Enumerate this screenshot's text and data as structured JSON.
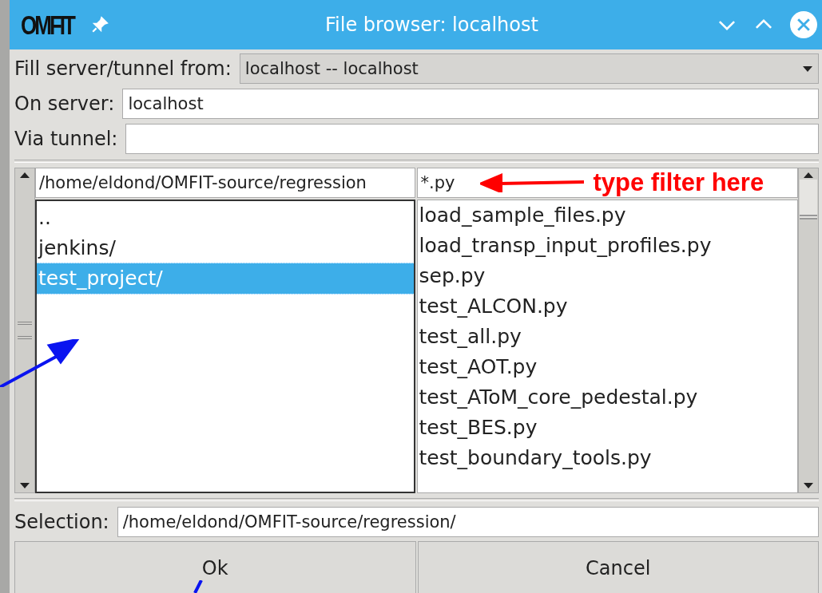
{
  "window": {
    "title": "File browser: localhost",
    "logo": "OMFIT"
  },
  "fill_from": {
    "label": "Fill server/tunnel from:",
    "value": "localhost -- localhost"
  },
  "on_server": {
    "label": "On server:",
    "value": "localhost"
  },
  "via_tunnel": {
    "label": "Via tunnel:"
  },
  "path": {
    "value": "/home/eldond/OMFIT-source/regression"
  },
  "filter": {
    "value": "*.py"
  },
  "annotation": {
    "text": "type filter here"
  },
  "directories": [
    {
      "name": "..",
      "selected": false
    },
    {
      "name": "jenkins/",
      "selected": false
    },
    {
      "name": "test_project/",
      "selected": true
    }
  ],
  "files": [
    "load_sample_files.py",
    "load_transp_input_profiles.py",
    "sep.py",
    "test_ALCON.py",
    "test_all.py",
    "test_AOT.py",
    "test_AToM_core_pedestal.py",
    "test_BES.py",
    "test_boundary_tools.py"
  ],
  "selection": {
    "label": "Selection:",
    "value": "/home/eldond/OMFIT-source/regression/"
  },
  "buttons": [
    "Ok",
    "Cancel"
  ]
}
